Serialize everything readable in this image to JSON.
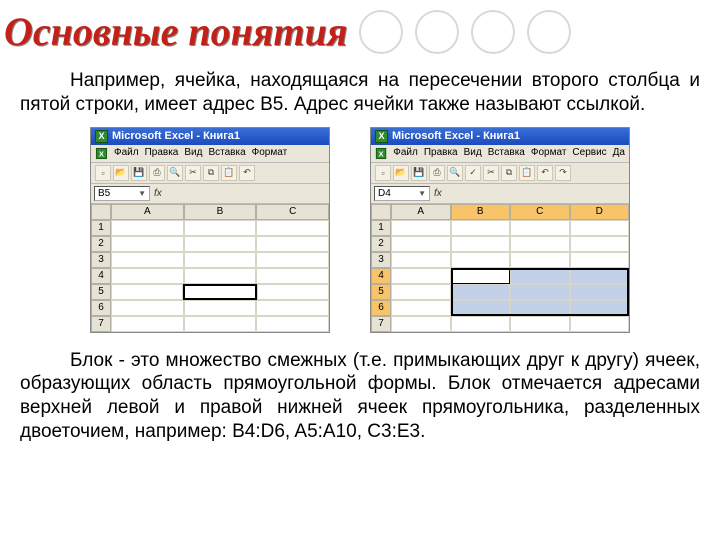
{
  "title": "Основные понятия",
  "paragraph1": "Например, ячейка, находящаяся на пересечении второго столбца и пятой строки, имеет адрес B5. Адрес ячейки также называют ссылкой.",
  "paragraph2": "Блок - это множество смежных (т.е. примыкающих друг к другу) ячеек, образующих область прямоугольной формы. Блок отмечается адресами верхней левой и правой нижней ячеек прямоугольника, разделенных двоеточием, например: B4:D6, A5:A10, C3:E3.",
  "excel1": {
    "titlebar": "Microsoft Excel - Книга1",
    "menu": [
      "Файл",
      "Правка",
      "Вид",
      "Вставка",
      "Формат"
    ],
    "namebox": "B5",
    "cols": [
      "A",
      "B",
      "C"
    ],
    "rows": [
      "1",
      "2",
      "3",
      "4",
      "5",
      "6",
      "7"
    ]
  },
  "excel2": {
    "titlebar": "Microsoft Excel - Книга1",
    "menu": [
      "Файл",
      "Правка",
      "Вид",
      "Вставка",
      "Формат",
      "Сервис",
      "Да"
    ],
    "namebox": "D4",
    "cols": [
      "A",
      "B",
      "C",
      "D"
    ],
    "rows": [
      "1",
      "2",
      "3",
      "4",
      "5",
      "6",
      "7"
    ]
  }
}
